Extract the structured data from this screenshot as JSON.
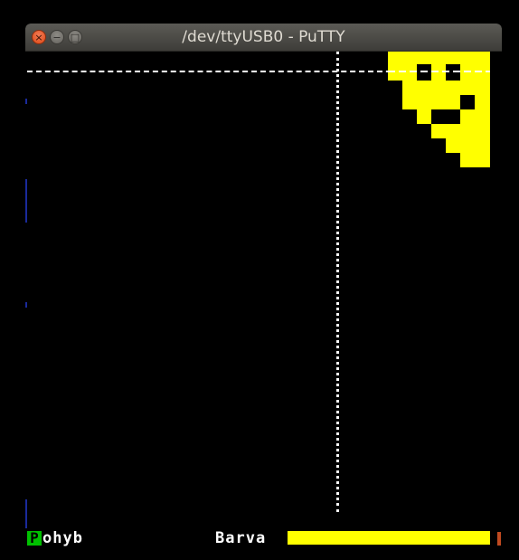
{
  "window": {
    "title": "/dev/ttyUSB0 - PuTTY",
    "controls": {
      "close_glyph": "×",
      "minimize_glyph": "−",
      "maximize_glyph": "□"
    }
  },
  "terminal": {
    "background_color": "#000000",
    "line_color": "#ffffff",
    "sprite_color": "#ffff00",
    "status": {
      "cursor_char": "P",
      "mode_label_rest": "ohyb",
      "color_label": "Barva",
      "color_value": "#ffff00",
      "cursor_color": "#00c000",
      "marker_color": "#c04a20"
    }
  }
}
